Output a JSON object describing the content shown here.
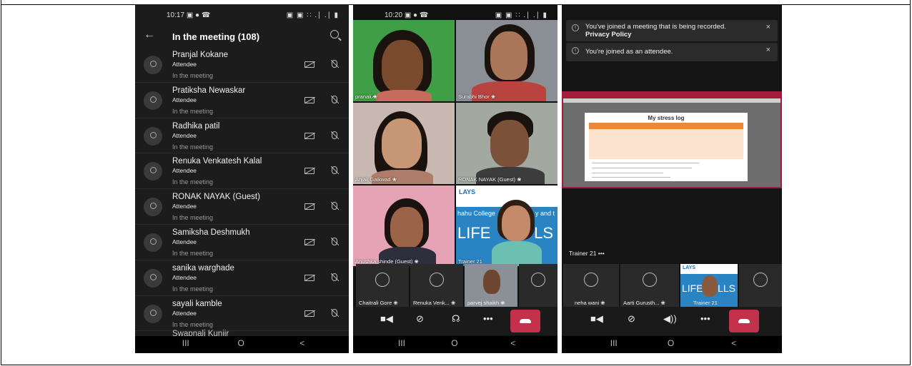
{
  "phone1": {
    "status_time": "10:17",
    "status_icons": "▣ ● ☎",
    "status_right": "▣ ▣ ∷ .∣ .∣ ▮",
    "back_icon": "←",
    "title": "In the meeting (108)",
    "participants": [
      {
        "name": "Pranjal Kokane",
        "role": "Attendee",
        "status": "In the meeting"
      },
      {
        "name": "Pratiksha Newaskar",
        "role": "Attendee",
        "status": "In the meeting"
      },
      {
        "name": "Radhika patil",
        "role": "Attendee",
        "status": "In the meeting"
      },
      {
        "name": "Renuka Venkatesh Kalal",
        "role": "Attendee",
        "status": "In the meeting"
      },
      {
        "name": "RONAK NAYAK (Guest)",
        "role": "Attendee",
        "status": "In the meeting"
      },
      {
        "name": "Samiksha Deshmukh",
        "role": "Attendee",
        "status": "In the meeting"
      },
      {
        "name": "sanika warghade",
        "role": "Attendee",
        "status": "In the meeting"
      },
      {
        "name": "sayali kamble",
        "role": "Attendee",
        "status": "In the meeting"
      }
    ],
    "partial_name": "Swapnali Kunjir",
    "nav": [
      "III",
      "O",
      "<"
    ]
  },
  "phone2": {
    "status_time": "10:20",
    "status_icons": "▣ ● ☎",
    "status_right": "▣ ▣ ∷ .∣ .∣ ▮",
    "tiles": [
      {
        "label": "pranali ̷❀"
      },
      {
        "label": "Surabhi Bhor ❀"
      },
      {
        "label": "Anjali Gaikwad ❀"
      },
      {
        "label": "RONAK NAYAK (Guest) ❀"
      },
      {
        "label": "Anushka shinde (Guest) ❀"
      },
      {
        "label": "Trainer 21"
      }
    ],
    "banner_top": "LAYS",
    "banner_mid": "hahu College",
    "banner_mid2": "y and t",
    "banner_big": "LIFE",
    "banner_big2": "LS",
    "strip": [
      {
        "label": "Chaitrali Gore ❀"
      },
      {
        "label": "Renuka Venk... ❀"
      },
      {
        "label": "parvej shaikh ❀"
      }
    ],
    "controls": [
      "■◀",
      "⊘",
      "☊",
      "•••"
    ],
    "nav": [
      "III",
      "O",
      "<"
    ]
  },
  "phone3": {
    "notice1_line1": "You've joined a meeting that is being recorded.",
    "notice1_line2": "Privacy Policy",
    "notice2": "You're joined as an attendee.",
    "info_icon": "i",
    "close_icon": "×",
    "slide_title": "My stress log",
    "speaker_label": "Trainer 21  •••",
    "strip": [
      {
        "label": "neha wani ❀"
      },
      {
        "label": "Aarti Gurusth... ❀"
      },
      {
        "label": "Trainer 21"
      }
    ],
    "strip_banner": "LAYS",
    "strip_banner_big": "LIFE",
    "strip_banner_big2": "LLS",
    "controls": [
      "■◀",
      "⊘",
      "◀))",
      "•••"
    ],
    "nav": [
      "III",
      "O",
      "<"
    ]
  },
  "colors": {
    "end_call": "#c4314b",
    "share_border": "#a41b3b",
    "slide_header": "#e88a3a",
    "phone_bg": "#1c1c1c"
  }
}
